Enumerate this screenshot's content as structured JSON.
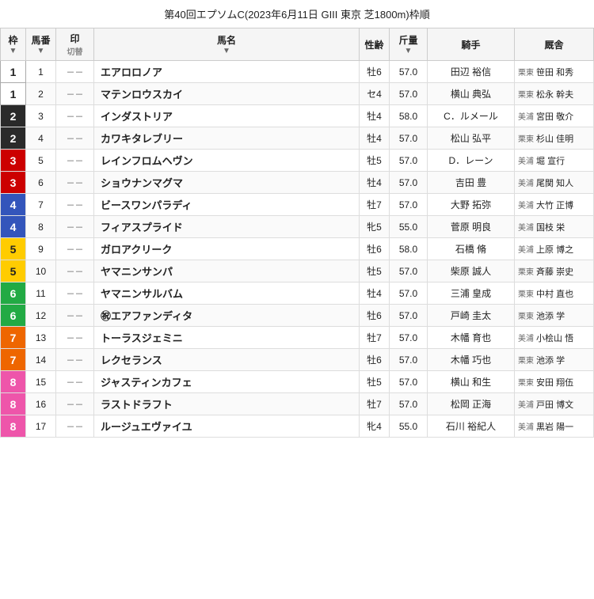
{
  "title": "第40回エプソムC(2023年6月11日 GIII 東京 芝1800m)枠順",
  "headers": {
    "waku": "枠",
    "bango": "馬番",
    "shirushi": "印",
    "shirushi_sub": "切替",
    "uma": "馬名",
    "seire": "性齢",
    "kinryo": "斤量",
    "kishi": "騎手",
    "basha": "厩舎"
  },
  "rows": [
    {
      "waku": 1,
      "bango": 1,
      "uma": "エアロロノア",
      "seire": "牡6",
      "kinryo": "57.0",
      "kishi": "田辺 裕信",
      "basha_region": "栗東",
      "basha_trainer": "笹田 和秀"
    },
    {
      "waku": 1,
      "bango": 2,
      "uma": "マテンロウスカイ",
      "seire": "セ4",
      "kinryo": "57.0",
      "kishi": "横山 典弘",
      "basha_region": "栗東",
      "basha_trainer": "松永 幹夫"
    },
    {
      "waku": 2,
      "bango": 3,
      "uma": "インダストリア",
      "seire": "牡4",
      "kinryo": "58.0",
      "kishi": "C．ルメール",
      "basha_region": "美浦",
      "basha_trainer": "宮田 敬介"
    },
    {
      "waku": 2,
      "bango": 4,
      "uma": "カワキタレブリー",
      "seire": "牡4",
      "kinryo": "57.0",
      "kishi": "松山 弘平",
      "basha_region": "栗東",
      "basha_trainer": "杉山 佳明"
    },
    {
      "waku": 3,
      "bango": 5,
      "uma": "レインフロムヘヴン",
      "seire": "牡5",
      "kinryo": "57.0",
      "kishi": "D．レーン",
      "basha_region": "美浦",
      "basha_trainer": "堀 宣行"
    },
    {
      "waku": 3,
      "bango": 6,
      "uma": "ショウナンマグマ",
      "seire": "牡4",
      "kinryo": "57.0",
      "kishi": "吉田 豊",
      "basha_region": "美浦",
      "basha_trainer": "尾関 知人"
    },
    {
      "waku": 4,
      "bango": 7,
      "uma": "ビースワンパラディ",
      "seire": "牡7",
      "kinryo": "57.0",
      "kishi": "大野 拓弥",
      "basha_region": "美浦",
      "basha_trainer": "大竹 正博"
    },
    {
      "waku": 4,
      "bango": 8,
      "uma": "フィアスプライド",
      "seire": "牝5",
      "kinryo": "55.0",
      "kishi": "菅原 明良",
      "basha_region": "美浦",
      "basha_trainer": "国枝 栄"
    },
    {
      "waku": 5,
      "bango": 9,
      "uma": "ガロアクリーク",
      "seire": "牡6",
      "kinryo": "58.0",
      "kishi": "石橋 脩",
      "basha_region": "美浦",
      "basha_trainer": "上原 博之"
    },
    {
      "waku": 5,
      "bango": 10,
      "uma": "ヤマニンサンパ",
      "seire": "牡5",
      "kinryo": "57.0",
      "kishi": "柴原 誠人",
      "basha_region": "栗東",
      "basha_trainer": "斉藤 崇史"
    },
    {
      "waku": 6,
      "bango": 11,
      "uma": "ヤマニンサルバム",
      "seire": "牡4",
      "kinryo": "57.0",
      "kishi": "三浦 皇成",
      "basha_region": "栗東",
      "basha_trainer": "中村 直也"
    },
    {
      "waku": 6,
      "bango": 12,
      "uma": "㊗エアファンディタ",
      "seire": "牡6",
      "kinryo": "57.0",
      "kishi": "戸崎 圭太",
      "basha_region": "栗東",
      "basha_trainer": "池添 学"
    },
    {
      "waku": 7,
      "bango": 13,
      "uma": "トーラスジェミニ",
      "seire": "牡7",
      "kinryo": "57.0",
      "kishi": "木幡 育也",
      "basha_region": "美浦",
      "basha_trainer": "小桧山 悟"
    },
    {
      "waku": 7,
      "bango": 14,
      "uma": "レクセランス",
      "seire": "牡6",
      "kinryo": "57.0",
      "kishi": "木幡 巧也",
      "basha_region": "栗東",
      "basha_trainer": "池添 学"
    },
    {
      "waku": 8,
      "bango": 15,
      "uma": "ジャスティンカフェ",
      "seire": "牡5",
      "kinryo": "57.0",
      "kishi": "横山 和生",
      "basha_region": "栗東",
      "basha_trainer": "安田 翔伍"
    },
    {
      "waku": 8,
      "bango": 16,
      "uma": "ラストドラフト",
      "seire": "牡7",
      "kinryo": "57.0",
      "kishi": "松岡 正海",
      "basha_region": "美浦",
      "basha_trainer": "戸田 博文"
    },
    {
      "waku": 8,
      "bango": 17,
      "uma": "ルージュエヴァイユ",
      "seire": "牝4",
      "kinryo": "55.0",
      "kishi": "石川 裕紀人",
      "basha_region": "美浦",
      "basha_trainer": "黒岩 陽一"
    }
  ],
  "waku_colors": {
    "1": {
      "bg": "#ffffff",
      "color": "#222222",
      "border": "1px solid #aaa"
    },
    "2": {
      "bg": "#2a2a2a",
      "color": "#ffffff"
    },
    "3": {
      "bg": "#cc0000",
      "color": "#ffffff"
    },
    "4": {
      "bg": "#3355bb",
      "color": "#ffffff"
    },
    "5": {
      "bg": "#ffcc00",
      "color": "#222222"
    },
    "6": {
      "bg": "#22aa44",
      "color": "#ffffff"
    },
    "7": {
      "bg": "#ee6600",
      "color": "#ffffff"
    },
    "8": {
      "bg": "#ee55aa",
      "color": "#ffffff"
    }
  }
}
